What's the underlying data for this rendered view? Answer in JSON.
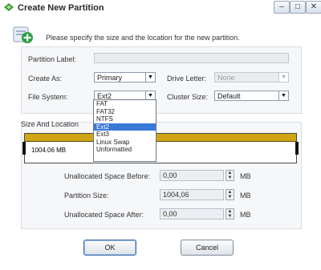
{
  "window": {
    "title": "Create New Partition",
    "minimize_glyph": "–",
    "maximize_glyph": "□",
    "close_glyph": "✕"
  },
  "header": {
    "text": "Please specify the size and the location for the new partition."
  },
  "form": {
    "partition_label": {
      "label": "Partition Label:",
      "value": ""
    },
    "create_as": {
      "label": "Create As:",
      "value": "Primary"
    },
    "drive_letter": {
      "label": "Drive Letter:",
      "value": "None"
    },
    "file_system": {
      "label": "File System:",
      "value": "Ext2"
    },
    "cluster_size": {
      "label": "Cluster Size:",
      "value": "Default"
    }
  },
  "file_system_options": [
    "FAT",
    "FAT32",
    "NTFS",
    "Ext2",
    "Ext3",
    "Linux Swap",
    "Unformatted"
  ],
  "file_system_selected_index": 3,
  "size_location": {
    "title": "Size And Location",
    "bar_label": "1004.06 MB",
    "bar_color": "#cfa514"
  },
  "spinners": {
    "before": {
      "label": "Unallocated Space Before:",
      "value": "0,00",
      "unit": "MB"
    },
    "size": {
      "label": "Partition Size:",
      "value": "1004,06",
      "unit": "MB"
    },
    "after": {
      "label": "Unallocated Space After:",
      "value": "0,00",
      "unit": "MB"
    }
  },
  "buttons": {
    "ok": "OK",
    "cancel": "Cancel"
  }
}
